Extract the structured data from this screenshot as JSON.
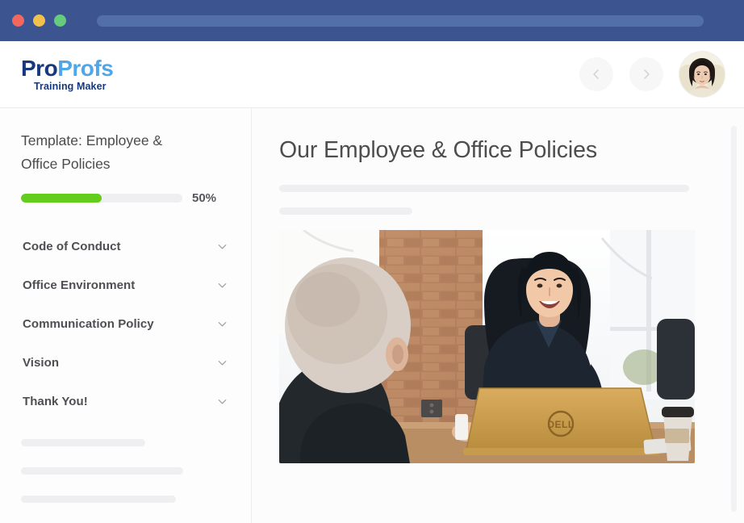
{
  "browser": {
    "window_controls": [
      {
        "name": "close",
        "color": "#f2685f"
      },
      {
        "name": "minimize",
        "color": "#f2c14c"
      },
      {
        "name": "maximize",
        "color": "#64cc7c"
      }
    ],
    "titlebar_color": "#3c548f",
    "urlbar_color": "#536fa9",
    "url_value": ""
  },
  "header": {
    "logo": {
      "part1": "Pro",
      "part2": "Profs",
      "subtitle": "Training Maker",
      "color1": "#16387c",
      "color2": "#4fa6e8"
    },
    "back_icon": "chevron-left-icon",
    "forward_icon": "chevron-right-icon",
    "avatar_alt": "user-avatar"
  },
  "sidebar": {
    "template_title": "Template: Employee & Office Policies",
    "progress": {
      "percent_label": "50%",
      "percent_value": 50,
      "fill_color": "#63cc1d",
      "track_color": "#efeff1"
    },
    "items": [
      {
        "label": "Code of Conduct",
        "icon": "chevron-down-icon"
      },
      {
        "label": "Office Environment",
        "icon": "chevron-down-icon"
      },
      {
        "label": "Communication Policy",
        "icon": "chevron-down-icon"
      },
      {
        "label": "Vision",
        "icon": "chevron-down-icon"
      },
      {
        "label": "Thank You!",
        "icon": "chevron-down-icon"
      }
    ],
    "placeholder_widths": [
      "154px",
      "201px",
      "192px"
    ]
  },
  "main": {
    "title": "Our Employee & Office Policies",
    "placeholder_widths": [
      "508px",
      "165px"
    ],
    "hero_image_alt": "two-colleagues-meeting-at-office-desk-with-laptop"
  }
}
